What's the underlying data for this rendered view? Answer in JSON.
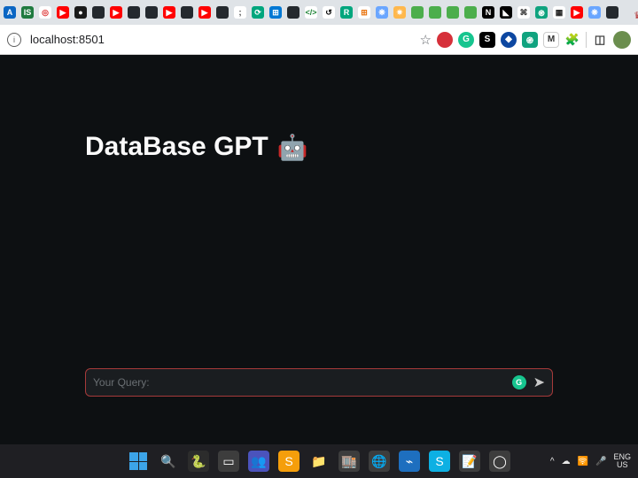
{
  "browser": {
    "url": "localhost:8501",
    "active_tab_close": "×",
    "new_tab": "+",
    "favicons": [
      {
        "bg": "#0b66c3",
        "txt": "A"
      },
      {
        "bg": "#1f7a3f",
        "txt": "IS"
      },
      {
        "bg": "#ffffff",
        "txt": "◎",
        "fg": "#d33"
      },
      {
        "bg": "#ff0000",
        "txt": "▶"
      },
      {
        "bg": "#1a1a1a",
        "txt": "●"
      },
      {
        "bg": "#24292e",
        "txt": " "
      },
      {
        "bg": "#ff0000",
        "txt": "▶"
      },
      {
        "bg": "#24292e",
        "txt": " "
      },
      {
        "bg": "#24292e",
        "txt": " "
      },
      {
        "bg": "#ff0000",
        "txt": "▶"
      },
      {
        "bg": "#24292e",
        "txt": " "
      },
      {
        "bg": "#ff0000",
        "txt": "▶"
      },
      {
        "bg": "#24292e",
        "txt": " "
      },
      {
        "bg": "#ffffff",
        "txt": ";",
        "fg": "#333"
      },
      {
        "bg": "#00a67d",
        "txt": "⟳"
      },
      {
        "bg": "#0078d4",
        "txt": "⊞"
      },
      {
        "bg": "#24292e",
        "txt": " "
      },
      {
        "bg": "#ffffff",
        "txt": "</>",
        "fg": "#22863a"
      },
      {
        "bg": "#ffffff",
        "txt": "↺",
        "fg": "#000"
      },
      {
        "bg": "#00a67d",
        "txt": "R"
      },
      {
        "bg": "#ffffff",
        "txt": "⊞",
        "fg": "#e8710a"
      },
      {
        "bg": "#6aa6ff",
        "txt": "❋"
      },
      {
        "bg": "#ffb84d",
        "txt": "✷"
      },
      {
        "bg": "#4cae4c",
        "txt": " "
      },
      {
        "bg": "#4cae4c",
        "txt": " "
      },
      {
        "bg": "#4cae4c",
        "txt": " "
      },
      {
        "bg": "#4cae4c",
        "txt": " "
      },
      {
        "bg": "#000000",
        "txt": "N"
      },
      {
        "bg": "#000000",
        "txt": "◣"
      },
      {
        "bg": "#ffffff",
        "txt": "⌘",
        "fg": "#333"
      },
      {
        "bg": "#10a37f",
        "txt": "֎"
      },
      {
        "bg": "#ffffff",
        "txt": "▦",
        "fg": "#222"
      },
      {
        "bg": "#ff0000",
        "txt": "▶"
      },
      {
        "bg": "#6aa6ff",
        "txt": "❋"
      },
      {
        "bg": "#24292e",
        "txt": " "
      }
    ],
    "extensions": [
      {
        "bg": "#d6303a",
        "txt": "",
        "shape": "circle"
      },
      {
        "bg": "#17c58f",
        "txt": "G",
        "shape": "circle"
      },
      {
        "bg": "#000000",
        "txt": "S",
        "shape": "square",
        "fg": "#fff"
      },
      {
        "bg": "#0d47a1",
        "txt": "◆",
        "shape": "circle"
      },
      {
        "bg": "#10a37f",
        "txt": "֎",
        "shape": "square"
      },
      {
        "bg": "#ffffff",
        "txt": "M",
        "shape": "square",
        "fg": "#333",
        "border": true
      }
    ],
    "icons": {
      "puzzle": "🧩",
      "panel": "◫"
    }
  },
  "app": {
    "title": "DataBase GPT",
    "title_emoji": "🤖",
    "query_placeholder": "Your Query:",
    "send_glyph": "➤"
  },
  "taskbar": {
    "items": [
      {
        "name": "start",
        "glyph": "win"
      },
      {
        "name": "search",
        "glyph": "🔍"
      },
      {
        "name": "pycharm",
        "glyph": "🐍",
        "bg": "#2c2c2c"
      },
      {
        "name": "task-view",
        "glyph": "▭",
        "bg": "#3d3d3d"
      },
      {
        "name": "teams",
        "glyph": "👥",
        "bg": "#4b53bc"
      },
      {
        "name": "sublime",
        "glyph": "S",
        "bg": "#f59e0b"
      },
      {
        "name": "explorer",
        "glyph": "📁"
      },
      {
        "name": "store",
        "glyph": "🏬",
        "bg": "#3d3d3d"
      },
      {
        "name": "chrome",
        "glyph": "🌐",
        "bg": "#3d3d3d"
      },
      {
        "name": "vscode",
        "glyph": "⌁",
        "bg": "#1e6fbf"
      },
      {
        "name": "skype",
        "glyph": "S",
        "bg": "#0db0e3"
      },
      {
        "name": "notepad",
        "glyph": "📝",
        "bg": "#3d3d3d"
      },
      {
        "name": "app",
        "glyph": "◯",
        "bg": "#3d3d3d"
      }
    ],
    "tray": {
      "chevron": "^",
      "cloud": "☁",
      "net": "🛜",
      "mic": "🎤",
      "lang_top": "ENG",
      "lang_bot": "US"
    }
  }
}
